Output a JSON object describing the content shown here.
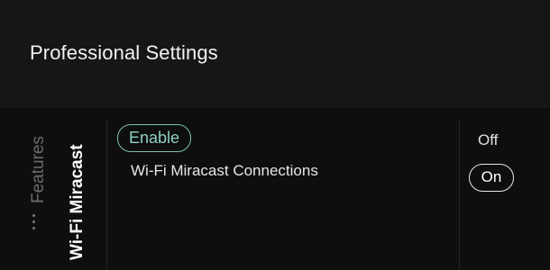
{
  "header": {
    "title": "Professional Settings"
  },
  "nav": {
    "parent_label": "Features",
    "current_label": "Wi-Fi Miracast",
    "more_icon": "ellipsis-vertical-icon"
  },
  "setting": {
    "status_label": "Enable",
    "name": "Wi-Fi Miracast Connections",
    "options": [
      "Off",
      "On"
    ],
    "selected": "On"
  },
  "colors": {
    "background": "#0e0e0e",
    "header_background": "#161616",
    "accent": "#8fd0c3"
  }
}
